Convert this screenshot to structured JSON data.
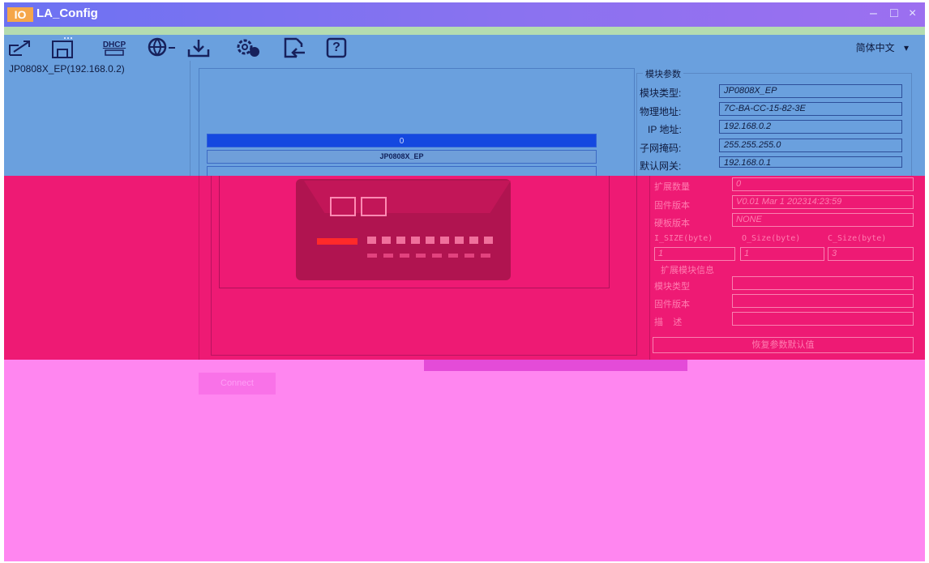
{
  "window": {
    "logo": "IO",
    "title": "LA_Config",
    "controls": {
      "minimize": "–",
      "maximize": "□",
      "close": "×"
    }
  },
  "toolbar": {
    "dhcp_label": "DHCP",
    "language": "简体中文",
    "language_arrow": "▾",
    "help_label": "?"
  },
  "device_list": {
    "items": [
      "JP0808X_EP(192.168.0.2)"
    ]
  },
  "preview": {
    "progress_label": "0",
    "device_name": "JP0808X_EP"
  },
  "module_params": {
    "title": "模块参数",
    "rows": [
      {
        "label": "模块类型:",
        "value": "JP0808X_EP"
      },
      {
        "label": "物理地址:",
        "value": "7C-BA-CC-15-82-3E"
      },
      {
        "label": "IP 地址:",
        "value": "192.168.0.2"
      },
      {
        "label": "子网掩码:",
        "value": "255.255.255.0"
      },
      {
        "label": "默认网关:",
        "value": "192.168.0.1"
      }
    ]
  },
  "hidden_params": {
    "rows": [
      {
        "label": "扩展数量",
        "value": "0"
      },
      {
        "label": "固件版本",
        "value": "V0.01 Mar  1 202314:23:59"
      },
      {
        "label": "硬板版本",
        "value": "NONE"
      }
    ],
    "size_headers": [
      "I_SIZE(byte)",
      "O_Size(byte)",
      "C_Size(byte)"
    ],
    "size_values": [
      "1",
      "1",
      "3"
    ],
    "ext_title": "扩展模块信息",
    "ext_rows": [
      {
        "label": "模块类型"
      },
      {
        "label": "固件版本"
      },
      {
        "label": "描    述"
      }
    ],
    "reset_button": "恢复参数默认值"
  },
  "lower": {
    "button": "Connect"
  }
}
